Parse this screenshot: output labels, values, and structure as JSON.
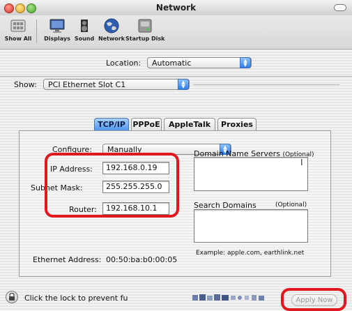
{
  "window": {
    "title": "Network"
  },
  "toolbar": {
    "show_all": "Show All",
    "items": [
      "Displays",
      "Sound",
      "Network",
      "Startup Disk"
    ]
  },
  "location": {
    "label": "Location:",
    "value": "Automatic"
  },
  "show": {
    "label": "Show:",
    "value": "PCI Ethernet Slot C1"
  },
  "tabs": [
    "TCP/IP",
    "PPPoE",
    "AppleTalk",
    "Proxies"
  ],
  "active_tab": "TCP/IP",
  "tcpip": {
    "configure_label": "Configure:",
    "configure_value": "Manually",
    "ip_label": "IP Address:",
    "ip_value": "192.168.0.19",
    "subnet_label": "Subnet Mask:",
    "subnet_value": "255.255.255.0",
    "router_label": "Router:",
    "router_value": "192.168.10.1",
    "dns_label": "Domain Name Servers",
    "dns_optional": "(Optional)",
    "search_label": "Search Domains",
    "search_optional": "(Optional)",
    "example": "Example: apple.com, earthlink.net",
    "ethernet_label": "Ethernet Address:",
    "ethernet_value": "00:50:ba:b0:00:05"
  },
  "bottom": {
    "lock_text": "Click the lock to prevent fu",
    "apply_label": "Apply Now"
  },
  "colors": {
    "highlight": "#e1191f",
    "tab_active": "#4f95ea"
  }
}
